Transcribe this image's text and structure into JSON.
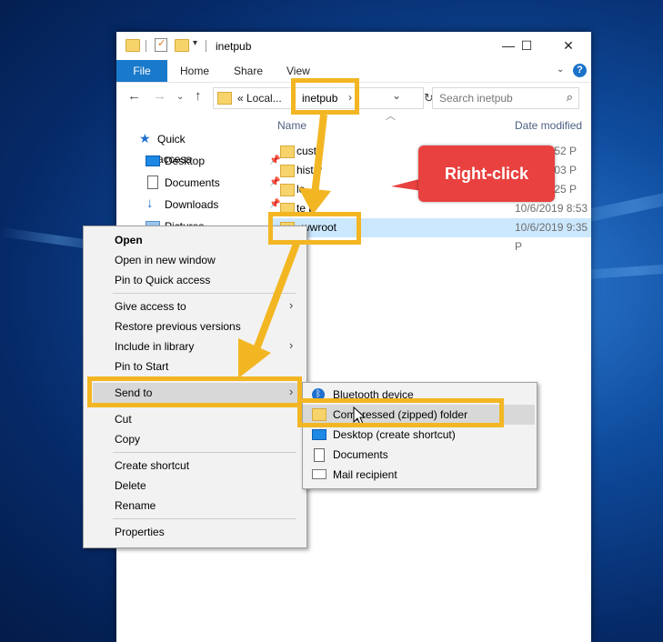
{
  "window": {
    "title": "inetpub",
    "controls": {
      "minimize": "—",
      "maximize": "☐",
      "close": "✕"
    }
  },
  "ribbon": {
    "tabs": [
      "File",
      "Home",
      "Share",
      "View"
    ],
    "help": "?"
  },
  "address_bar": {
    "prefix": "«  Local...",
    "current": "inetpub",
    "separator": "›",
    "dropdown": "⌄",
    "search_placeholder": "Search inetpub"
  },
  "navigation_pane": {
    "items": [
      {
        "label": "Quick access",
        "icon": "star-icon",
        "pinned": false
      },
      {
        "label": "Desktop",
        "icon": "desktop-icon",
        "pinned": true
      },
      {
        "label": "Documents",
        "icon": "documents-icon",
        "pinned": true
      },
      {
        "label": "Downloads",
        "icon": "download-icon",
        "pinned": true
      },
      {
        "label": "Pictures",
        "icon": "pictures-icon",
        "pinned": false
      }
    ],
    "pin_glyph": "📌"
  },
  "columns": {
    "name": "Name",
    "date_modified": "Date modified"
  },
  "files": [
    {
      "name": "custerr",
      "date": "10/6/2019 8:52 PM"
    },
    {
      "name": "history",
      "date": "10/6/2019 9:03 PM"
    },
    {
      "name": "logs",
      "date": "10/6/2019 9:25 PM"
    },
    {
      "name": "temp",
      "date": "10/6/2019 8:53 PM"
    },
    {
      "name": "wwwroot",
      "date": "10/6/2019 9:35 PM",
      "selected": true
    }
  ],
  "visible_file_text": {
    "r0_name": "cust  r",
    "r0_date": "019 8:52 P",
    "r1_name": "hist  y",
    "r1_date": "019 9:03 P",
    "r2_name": "lo",
    "r2_date": "019 9:25 P",
    "r3_name": "te   p",
    "r3_date": "10/6/2019 8:53 P",
    "r4_name": "wwroot",
    "r4_date": "10/6/2019 9:35 P"
  },
  "context_menu": {
    "groups": [
      [
        "Open",
        "Open in new window",
        "Pin to Quick access"
      ],
      [
        "Give access to",
        "Restore previous versions",
        "Include in library",
        "Pin to Start"
      ],
      [
        "Send to"
      ],
      [
        "Cut",
        "Copy"
      ],
      [
        "Create shortcut",
        "Delete",
        "Rename"
      ],
      [
        "Properties"
      ]
    ],
    "submenu_arrow": "›"
  },
  "send_to_submenu": {
    "items": [
      {
        "label": "Bluetooth device",
        "icon": "bluetooth-icon"
      },
      {
        "label": "Compressed (zipped) folder",
        "icon": "zip-folder-icon",
        "highlighted": true
      },
      {
        "label": "Desktop (create shortcut)",
        "icon": "desktop-icon"
      },
      {
        "label": "Documents",
        "icon": "documents-icon"
      },
      {
        "label": "Mail recipient",
        "icon": "mail-icon"
      }
    ]
  },
  "annotation": {
    "callout_text": "Right-click",
    "highlight_color": "#f3b623",
    "callout_color": "#e8413f"
  },
  "colors": {
    "file_tab": "#1979ca",
    "selection": "#cce8ff",
    "desktop_bg": "#0f4c9e"
  }
}
